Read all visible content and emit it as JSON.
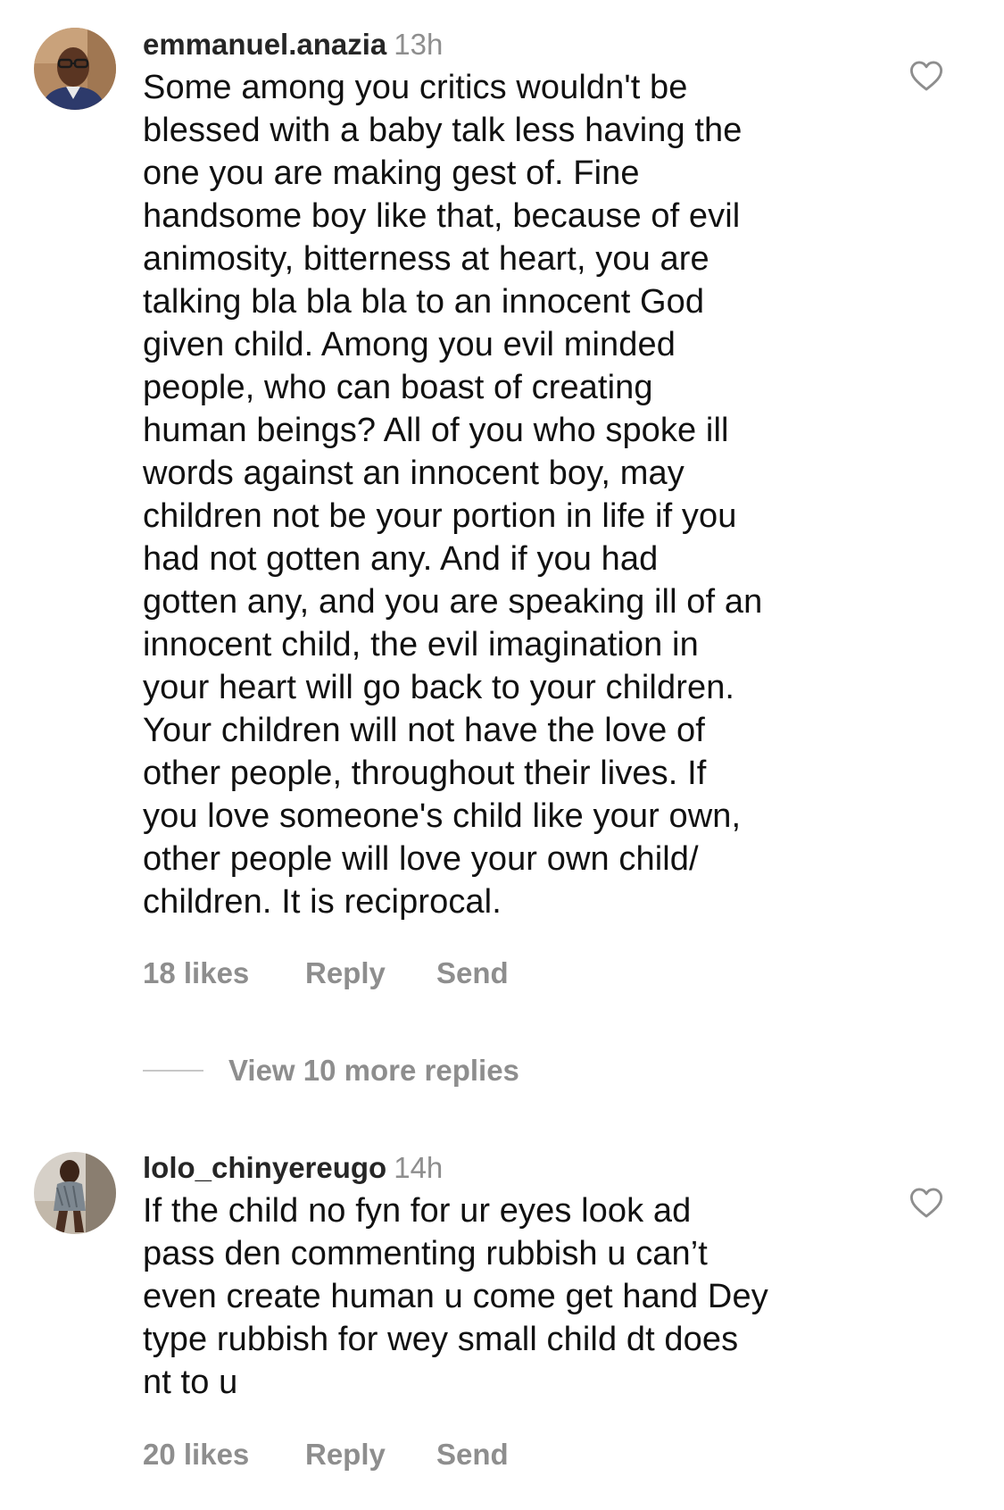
{
  "comments": [
    {
      "username": "emmanuel.anazia",
      "time": "13h",
      "text": "Some among you critics wouldn't be\nblessed with a baby talk less having the\none you are making gest of. Fine\nhandsome boy like that, because of evil\nanimosity, bitterness at heart, you are\ntalking bla bla bla to an innocent God\ngiven child. Among you evil minded\npeople, who can boast of creating\nhuman beings? All of you who spoke ill\nwords against an innocent boy, may\nchildren not be your portion in life if you\nhad not gotten any. And if you had\ngotten any, and you are speaking ill of an\ninnocent child, the evil imagination in\nyour heart will go back to your children.\nYour children will not have the love of\nother people, throughout their lives. If\nyou love someone's child like your own,\nother people will love your own child/\nchildren. It is reciprocal.",
      "likes": "18 likes",
      "reply": "Reply",
      "send": "Send",
      "avatar_icon": "avatar-man-glasses"
    },
    {
      "username": "lolo_chinyereugo",
      "time": "14h",
      "text": "If the child no fyn for ur eyes look ad\npass den commenting rubbish u can’t\neven create human u come get hand Dey\ntype rubbish for wey small child dt does\nnt to u",
      "likes": "20 likes",
      "reply": "Reply",
      "send": "Send",
      "avatar_icon": "avatar-woman"
    }
  ],
  "view_replies": "View 10 more replies",
  "icons": {
    "like": "heart-outline-icon"
  },
  "colors": {
    "text": "#111111",
    "username": "#262626",
    "secondary": "#8e8e8e",
    "divider": "#c7c7c7",
    "background": "#ffffff"
  }
}
